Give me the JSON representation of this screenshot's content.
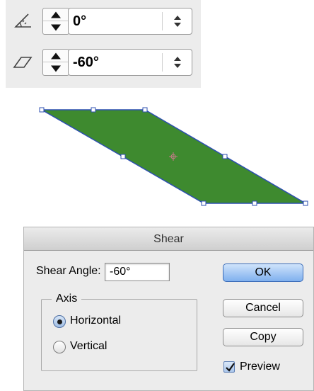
{
  "controls": {
    "rotate": {
      "icon": "rotate-angle-icon",
      "value": "0°"
    },
    "shear": {
      "icon": "shear-angle-icon",
      "value": "-60°"
    }
  },
  "artwork": {
    "fill_color": "#3e8a2f",
    "stroke_color": "#2c4fb0"
  },
  "dialog": {
    "title": "Shear",
    "angle_label": "Shear Angle:",
    "angle_value": "-60°",
    "axis_label": "Axis",
    "axis_options": [
      {
        "label": "Horizontal",
        "selected": true
      },
      {
        "label": "Vertical",
        "selected": false
      }
    ],
    "buttons": {
      "ok": "OK",
      "cancel": "Cancel",
      "copy": "Copy"
    },
    "preview": {
      "label": "Preview",
      "checked": true
    }
  }
}
